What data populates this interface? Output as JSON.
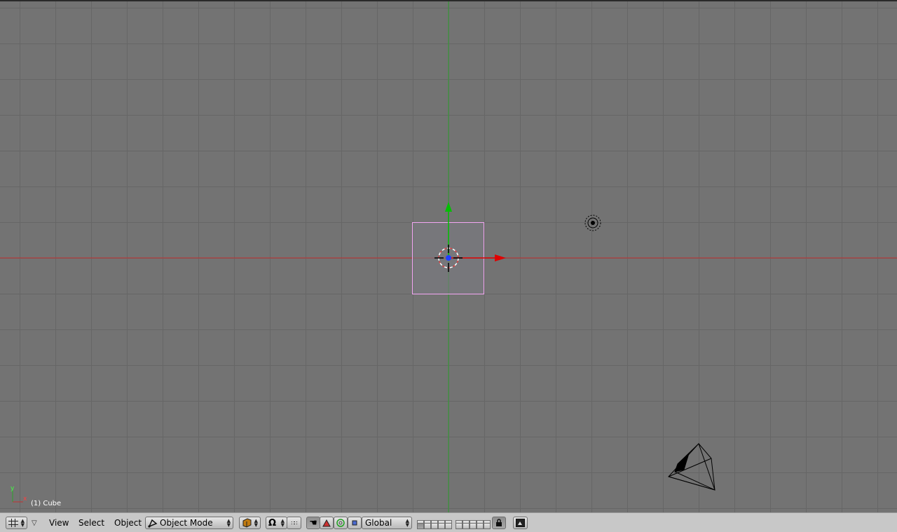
{
  "viewport": {
    "active_object_label": "(1) Cube",
    "axis_widget": {
      "x_label": "x",
      "y_label": "y"
    },
    "colors": {
      "background": "#737373",
      "grid": "#666666",
      "x_axis": "#c23030",
      "y_axis": "#2fa12f",
      "selection": "#f0a0f0",
      "manipulator_x": "#e00000",
      "manipulator_y": "#00c000"
    }
  },
  "header": {
    "editor_type_icon": "grid-icon",
    "menus": {
      "view": "View",
      "select": "Select",
      "object": "Object"
    },
    "mode": {
      "label": "Object Mode",
      "icon": "object-mode-icon"
    },
    "draw_type_icon": "solid-cube-icon",
    "pivot_icon": "pivot-icon",
    "manipulator": {
      "hand_icon": "hand-icon",
      "translate_icon": "translate-triangle-icon",
      "rotate_icon": "rotate-circle-icon",
      "scale_icon": "scale-square-icon"
    },
    "orientation": "Global",
    "lock_icon": "lock-icon",
    "render_icon": "render-icon"
  }
}
